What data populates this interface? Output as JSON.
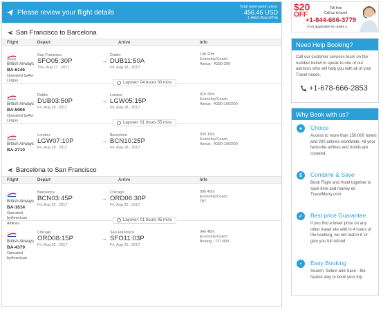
{
  "header": {
    "title": "Please review your flight details",
    "price_label": "Total reservation price:",
    "price": "456.46 USD",
    "price_sub": "1 Adult,RoundTrip"
  },
  "columns": {
    "flight": "Flight",
    "depart": "Depart",
    "arrive": "Arrive",
    "info": "Info"
  },
  "outbound": {
    "title": "San Francisco to Barcelona",
    "segments": [
      {
        "airline": "British Airways",
        "flight_no": "BA-6146",
        "operated": "Operated byAer Lingus",
        "dep_city": "San Francisco",
        "dep_time": "SFO05:30P",
        "dep_date": "Thu, Aug 17 , 2017",
        "arr_city": "Dublin",
        "arr_time": "DUB11:50A",
        "arr_date": "Fri, Aug 18 , 2017",
        "duration": "10h 20m",
        "cabin": "Economy/Coach",
        "aircraft": "Airbus - A330-200"
      },
      {
        "airline": "British Airways",
        "flight_no": "BA-5908",
        "operated": "Operated byAer Lingus",
        "dep_city": "Dublin",
        "dep_time": "DUB03:50P",
        "dep_date": "Fri, Aug 18 , 2017",
        "arr_city": "London",
        "arr_time": "LGW05:15P",
        "arr_date": "Fri, Aug 18 , 2017",
        "duration": "01h 25m",
        "cabin": "Economy/Coach",
        "aircraft": "Airbus - A320-100/200"
      },
      {
        "airline": "British Airways",
        "flight_no": "BA-2710",
        "operated": "",
        "dep_city": "London",
        "dep_time": "LGW07:10P",
        "dep_date": "Fri, Aug 18 , 2017",
        "arr_city": "Barcelona",
        "arr_time": "BCN10:25P",
        "arr_date": "Fri, Aug 18 , 2017",
        "duration": "02h 15m",
        "cabin": "Economy/Coach",
        "aircraft": "Airbus - A320-100/200"
      }
    ],
    "layovers": [
      "Layover: 04 hours 00 mins",
      "Layover: 01 hours 55 mins"
    ]
  },
  "return": {
    "title": "Barcelona to San Francisco",
    "segments": [
      {
        "airline": "British Airways",
        "flight_no": "BA-1614",
        "operated": "Operated byAmerican Airlines",
        "dep_city": "Barcelona",
        "dep_time": "BCN03:45P",
        "dep_date": "Fri, Aug 25 , 2017",
        "arr_city": "Chicago",
        "arr_time": "ORD06:30P",
        "arr_date": "Fri, Aug 25 , 2017",
        "duration": "09h 45m",
        "cabin": "Economy/Coach",
        "aircraft": "787"
      },
      {
        "airline": "British Airways",
        "flight_no": "BA-4379",
        "operated": "Operated byAmerican",
        "dep_city": "Chicago",
        "dep_time": "ORD08:15P",
        "dep_date": "Fri, Aug 25 , 2017",
        "arr_city": "San Francisco",
        "arr_time": "SFO11:03P",
        "arr_date": "Fri, Aug 25 , 2017",
        "duration": "04h 48m",
        "cabin": "Economy/Coach",
        "aircraft": "Boeing - 737-800"
      }
    ],
    "layovers": [
      "Layover: 01 hours 45 mins"
    ]
  },
  "ad": {
    "discount": "$20",
    "off": "OFF",
    "toll_free": "Toll free",
    "call_us": "Call us to book",
    "phone": "+1-844-666-3779",
    "note": "(*not applicable for online o"
  },
  "help": {
    "title": "Need Help Booking?",
    "text": "Call our customer services team on the number below to speak to one of our advisors who will help you with all of your Travel needs.",
    "phone": "+1-678-666-2853"
  },
  "why": {
    "title": "Why Book with us?",
    "items": [
      {
        "icon": "tag-icon",
        "glyph": "●",
        "title": "Choice",
        "text": "Access to more than 150,000 hotels and 200 airlines worldwide. All your favourite airlines and hotels are covered."
      },
      {
        "icon": "dollar-icon",
        "glyph": "$",
        "title": "Combine & Save",
        "text": "Book Flight and Hotel together to save time and money on TravelMerry.com"
      },
      {
        "icon": "thumbs-up-icon",
        "glyph": "✓",
        "title": "Best price Guarantee",
        "text": "If you find a lower price on any other travel site with in 4 hours of the booking, we will match it 'or' give you full refund."
      },
      {
        "icon": "briefcase-icon",
        "glyph": "▪",
        "title": "Easy Booking",
        "text": "Search, Select and Save - the fastest way to book your trip."
      }
    ]
  },
  "colors": {
    "accent": "#2a9fd8",
    "ad_red": "#e2293a"
  }
}
